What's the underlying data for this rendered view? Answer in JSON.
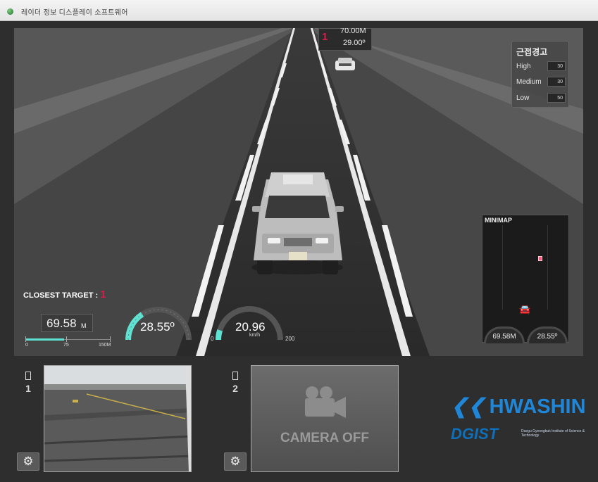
{
  "window": {
    "title": "레이더 정보 디스플레이 소프트웨어"
  },
  "target_label": {
    "id": "1",
    "distance": "70.00M",
    "angle": "29.00º"
  },
  "congestion_warning": {
    "title": "근접경고",
    "levels": [
      {
        "label": "High",
        "value": "30"
      },
      {
        "label": "Medium",
        "value": "30"
      },
      {
        "label": "Low",
        "value": "50"
      }
    ]
  },
  "closest_target": {
    "label": "CLOSEST TARGET :",
    "id": "1"
  },
  "distance_readout": {
    "value": "69.58",
    "unit": "M",
    "progress": 0.46,
    "scale_ticks": [
      "0",
      "75",
      "150M"
    ]
  },
  "angle_gauge": {
    "value": "28.55º",
    "level": 0.32
  },
  "speed_gauge": {
    "value": "20.96",
    "unit": "km/h",
    "min": "0",
    "max": "200",
    "level": 0.1
  },
  "minimap": {
    "title": "MINIMAP",
    "distance": "69.58M",
    "angle": "28.55º"
  },
  "cameras": [
    {
      "number": "1",
      "status": "on"
    },
    {
      "number": "2",
      "status": "off",
      "off_text": "CAMERA OFF"
    }
  ],
  "logos": {
    "company": "HWASHIN",
    "institute": "DGIST",
    "institute_subtitle": "Daegu Gyeongbuk Institute of Science & Technology"
  },
  "colors": {
    "accent_red": "#d81c4c",
    "gauge_cyan": "#5ee3d2",
    "logo_blue": "#1f86d8"
  },
  "icons": {
    "settings": "gear-icon",
    "camera": "video-camera-icon"
  }
}
